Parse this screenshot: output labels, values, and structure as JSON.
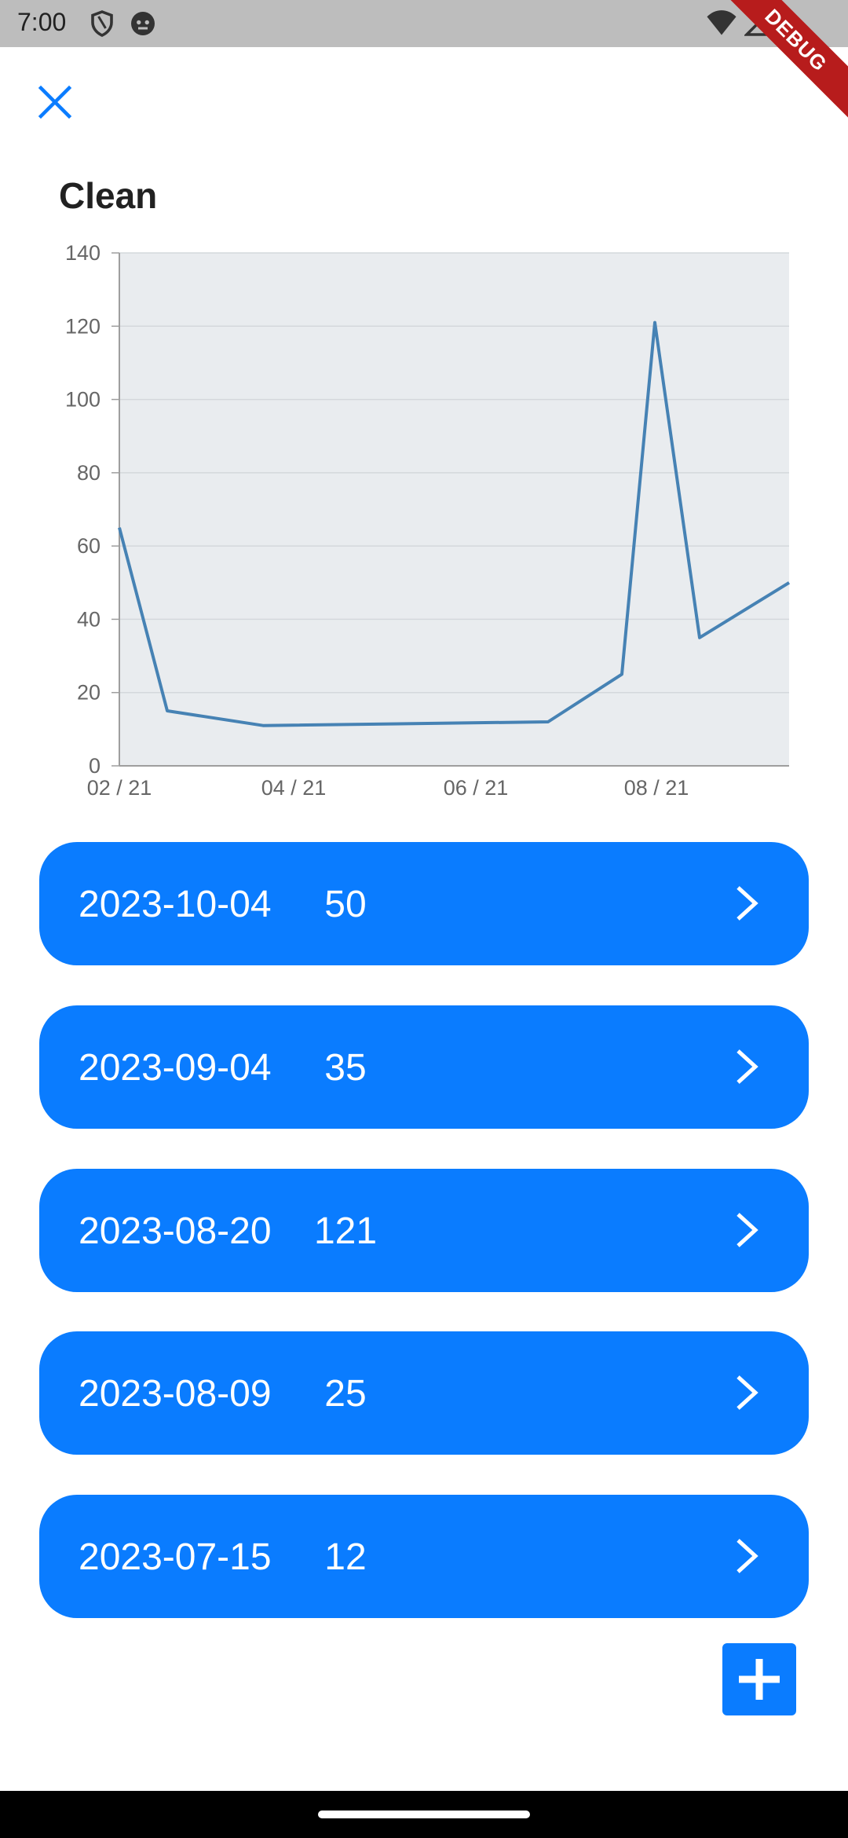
{
  "status_bar": {
    "time": "7:00"
  },
  "debug_banner": "DEBUG",
  "page": {
    "title": "Clean"
  },
  "chart_data": {
    "type": "line",
    "x_tick_labels": [
      "02 / 21",
      "04 / 21",
      "06 / 21",
      "08 / 21"
    ],
    "y_ticks": [
      0,
      20,
      40,
      60,
      80,
      100,
      120,
      140
    ],
    "ylim": [
      0,
      140
    ],
    "grid": true,
    "series": [
      {
        "values": [
          65,
          15,
          11,
          12,
          25,
          121,
          35,
          50
        ]
      }
    ],
    "colors": {
      "line": "#4682b4",
      "plot_bg": "#e9ecef",
      "grid": "#d4d8dc"
    }
  },
  "entries": [
    {
      "date": "2023-10-04",
      "value": "50"
    },
    {
      "date": "2023-09-04",
      "value": "35"
    },
    {
      "date": "2023-08-20",
      "value": "121"
    },
    {
      "date": "2023-08-09",
      "value": "25"
    },
    {
      "date": "2023-07-15",
      "value": "12"
    }
  ],
  "colors": {
    "accent": "#0a7cff"
  }
}
